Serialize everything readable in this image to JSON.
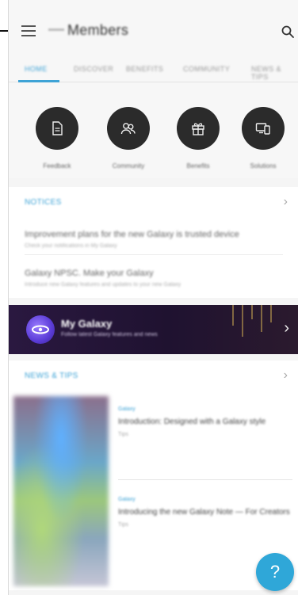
{
  "header": {
    "title": "Members"
  },
  "tabs": [
    {
      "label": "HOME"
    },
    {
      "label": "DISCOVER"
    },
    {
      "label": "BENEFITS"
    },
    {
      "label": "COMMUNITY"
    },
    {
      "label": "NEWS & TIPS"
    }
  ],
  "quick_actions": [
    {
      "label": "Feedback",
      "icon": "document-icon"
    },
    {
      "label": "Community",
      "icon": "people-icon"
    },
    {
      "label": "Benefits",
      "icon": "gift-icon"
    },
    {
      "label": "Solutions",
      "icon": "devices-icon"
    }
  ],
  "notices": {
    "title": "NOTICES",
    "items": [
      {
        "title": "Improvement plans for the new Galaxy is trusted device",
        "sub": "Check your notifications in My Galaxy"
      },
      {
        "title": "Galaxy NPSC. Make your Galaxy",
        "sub": "Introduce new Galaxy features and updates to your new Galaxy"
      }
    ]
  },
  "banner": {
    "title": "My Galaxy",
    "subtitle": "Follow latest Galaxy features and news"
  },
  "news": {
    "title": "NEWS & TIPS",
    "items": [
      {
        "category": "Galaxy",
        "title": "Introduction: Designed with a Galaxy style",
        "meta": "Tips"
      },
      {
        "category": "Galaxy",
        "title": "Introducing the new Galaxy Note — For Creators",
        "meta": "Tips"
      }
    ]
  },
  "fab": {
    "label": "?"
  },
  "colors": {
    "accent": "#3ea3d6",
    "quick_circle": "#2b2b2b",
    "banner_bg": "#1f1230",
    "fab": "#2fa7d8"
  }
}
